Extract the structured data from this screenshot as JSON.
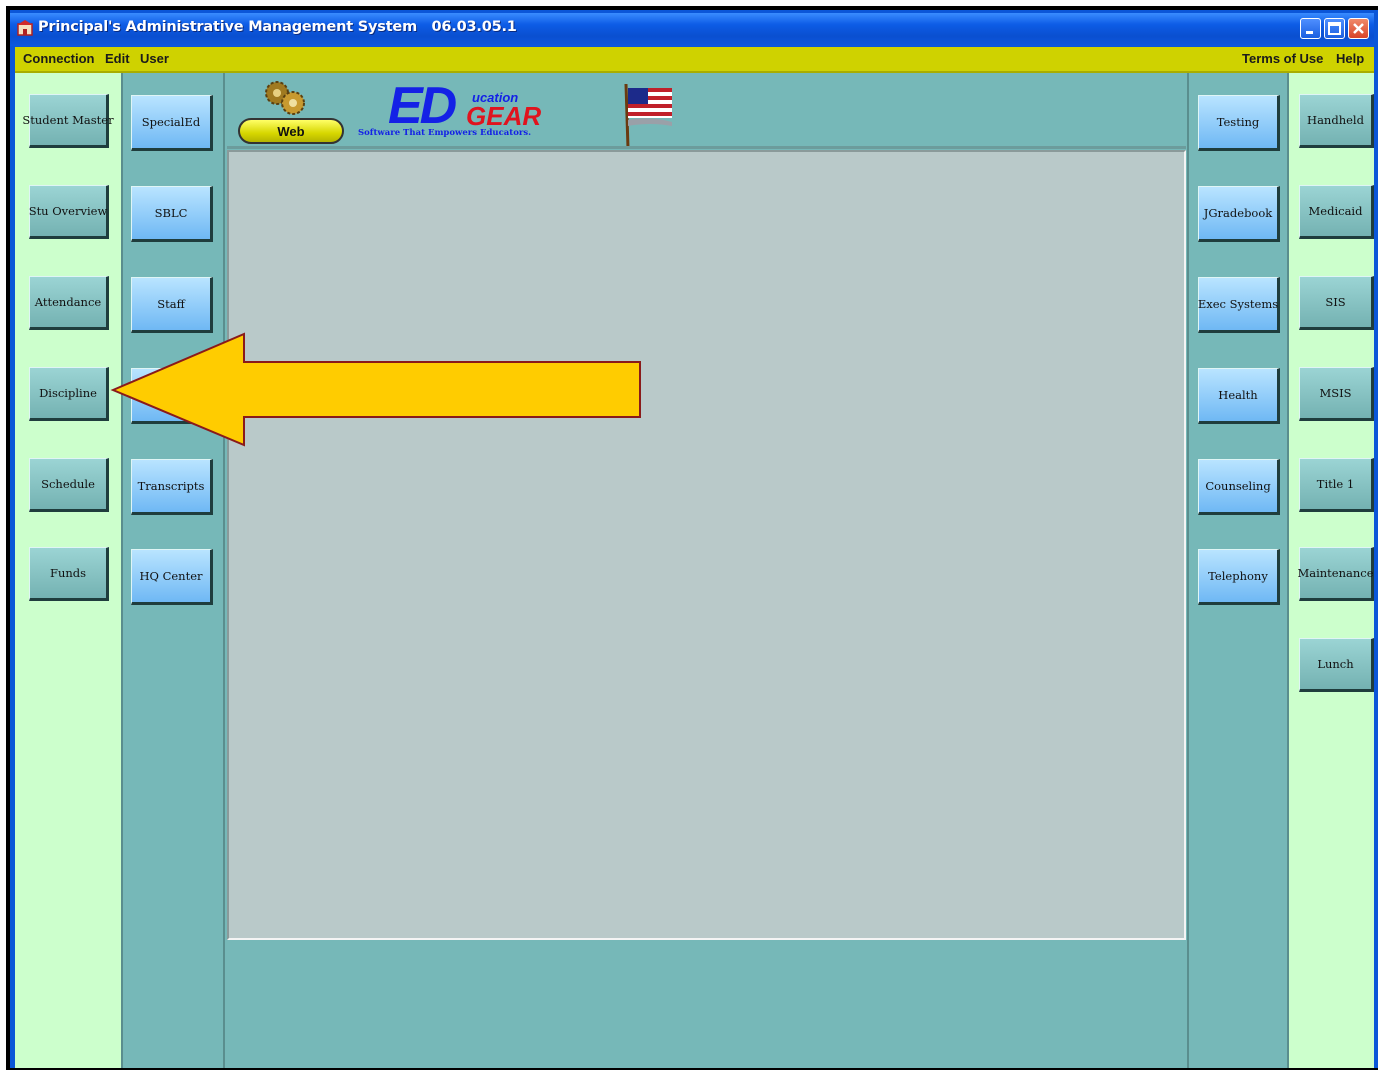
{
  "window": {
    "title": "Principal's Administrative Management System   06.03.05.1"
  },
  "menu": {
    "left": [
      "Connection",
      "Edit",
      "User"
    ],
    "right": [
      "Terms of Use",
      "Help"
    ]
  },
  "header": {
    "web_button": "Web",
    "logo": {
      "ed": "ED",
      "ucation": "ucation",
      "gear": "GEAR",
      "tagline": "Software That Empowers Educators."
    }
  },
  "left_column": [
    "Student Master",
    "Stu Overview",
    "Attendance",
    "Discipline",
    "Schedule",
    "Funds"
  ],
  "second_column": [
    "SpecialEd",
    "SBLC",
    "Staff",
    "",
    "Transcripts",
    "HQ Center"
  ],
  "right_inner_column": [
    "Testing",
    "JGradebook",
    "Exec Systems",
    "Health",
    "Counseling",
    "Telephony"
  ],
  "right_outer_column": [
    "Handheld",
    "Medicaid",
    "SIS",
    "MSIS",
    "Title 1",
    "Maintenance",
    "Lunch"
  ],
  "annotation": {
    "arrow_color": "#ffcc00",
    "arrow_border": "#8a1a1a",
    "points_to": "Discipline"
  },
  "colors": {
    "title_bar": "#0d57de",
    "menu_bar": "#cfd200",
    "panel": "#76b8b8",
    "side_columns": "#ccffcc",
    "content": "#b9c9c9"
  }
}
